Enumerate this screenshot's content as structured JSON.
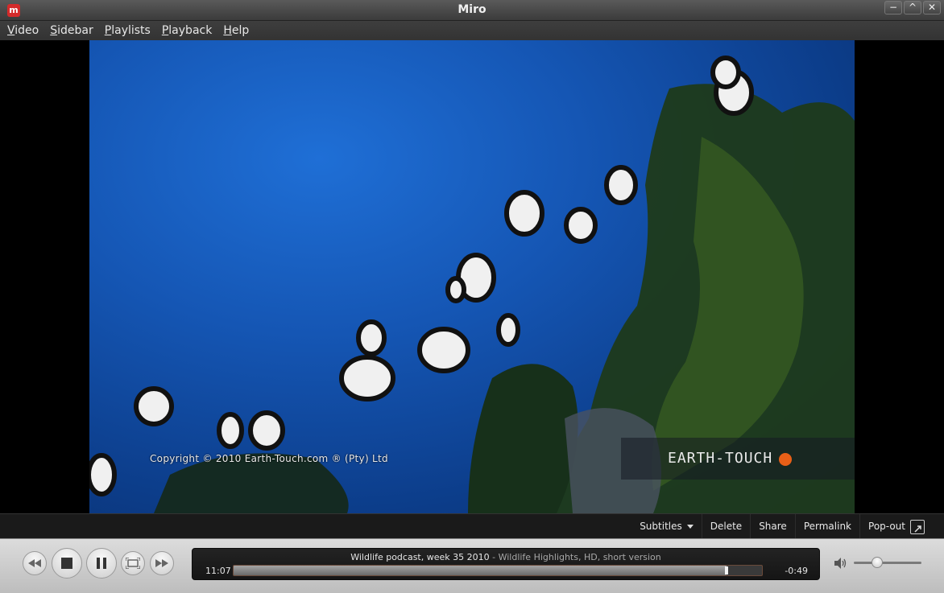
{
  "window": {
    "title": "Miro",
    "logo_letter": "m",
    "buttons": [
      "−",
      "^",
      "✕"
    ]
  },
  "menu": [
    {
      "mnemonic": "V",
      "rest": "ideo"
    },
    {
      "mnemonic": "S",
      "rest": "idebar"
    },
    {
      "mnemonic": "P",
      "rest": "laylists"
    },
    {
      "mnemonic": "P",
      "rest": "layback"
    },
    {
      "mnemonic": "H",
      "rest": "elp"
    }
  ],
  "video": {
    "copyright": "Copyright © 2010 Earth-Touch.com ® (Pty) Ltd",
    "brand": "EARTH-TOUCH",
    "brand_color": "#e85f17"
  },
  "toolbar": {
    "subtitles": "Subtitles",
    "delete": "Delete",
    "share": "Share",
    "permalink": "Permalink",
    "popout": "Pop-out"
  },
  "player": {
    "title": "Wildlife podcast, week 35 2010",
    "separator": " - ",
    "subtitle": "Wildlife Highlights, HD, short version",
    "elapsed": "11:07",
    "remaining": "-0:49",
    "progress": 0.93,
    "volume": 0.35,
    "icons": [
      "rewind-icon",
      "stop-icon",
      "pause-icon",
      "fullscreen-icon",
      "fast-forward-icon",
      "volume-icon"
    ]
  }
}
